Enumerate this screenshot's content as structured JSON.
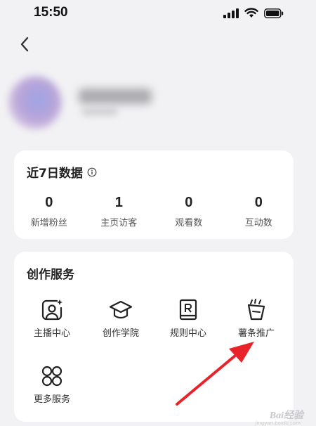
{
  "status_bar": {
    "time": "15:50",
    "icons": [
      "signal-icon",
      "wifi-icon",
      "battery-icon"
    ]
  },
  "header": {
    "back_icon": "chevron-left-icon"
  },
  "stats": {
    "title": "近7日数据",
    "info_icon": "info-icon",
    "items": [
      {
        "value": "0",
        "label": "新增粉丝"
      },
      {
        "value": "1",
        "label": "主页访客"
      },
      {
        "value": "0",
        "label": "观看数"
      },
      {
        "value": "0",
        "label": "互动数"
      }
    ]
  },
  "services": {
    "title": "创作服务",
    "items": [
      {
        "label": "主播中心",
        "icon": "anchor-center-icon"
      },
      {
        "label": "创作学院",
        "icon": "graduation-cap-icon"
      },
      {
        "label": "规则中心",
        "icon": "rule-book-icon"
      },
      {
        "label": "薯条推广",
        "icon": "fries-icon"
      },
      {
        "label": "更多服务",
        "icon": "grid-circles-icon"
      }
    ]
  },
  "annotation": {
    "arrow_color": "#e8232a"
  },
  "watermark": {
    "text": "Bai",
    "text2": "经验",
    "sub": "jingyan.baidu.com"
  }
}
